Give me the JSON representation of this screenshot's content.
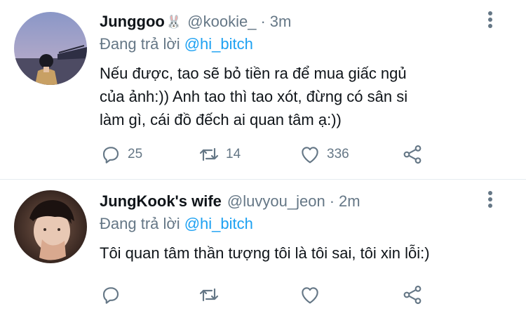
{
  "tweets": [
    {
      "display_name": "Junggoo",
      "name_emoji": "🐰",
      "handle": "@kookie_",
      "separator": "·",
      "time": "3m",
      "reply_label": "Đang trả lời",
      "reply_mention": "@hi_bitch",
      "text_lines": [
        "Nếu được, tao sẽ bỏ tiền ra để mua giấc ngủ",
        "của ảnh:)) Anh tao thì tao xót, đừng có sân si",
        "làm gì, cái đồ đếch ai quan tâm ạ:))"
      ],
      "stats": {
        "replies": "25",
        "retweets": "14",
        "likes": "336"
      }
    },
    {
      "display_name": "JungKook's wife",
      "handle": "@luvyou_jeon",
      "separator": "·",
      "time": "2m",
      "reply_label": "Đang trả lời",
      "reply_mention": "@hi_bitch",
      "text_lines": [
        "Tôi quan tâm thần tượng tôi là tôi sai, tôi xin lỗi:)"
      ],
      "stats": {
        "replies": "",
        "retweets": "",
        "likes": ""
      }
    }
  ],
  "icons": {
    "reply": "reply-icon",
    "retweet": "retweet-icon",
    "like": "heart-icon",
    "share": "share-icon",
    "more": "more-vertical-icon"
  },
  "colors": {
    "text": "#0f1419",
    "muted": "#657786",
    "mention": "#1da1f2",
    "divider": "#e6ecf0"
  }
}
